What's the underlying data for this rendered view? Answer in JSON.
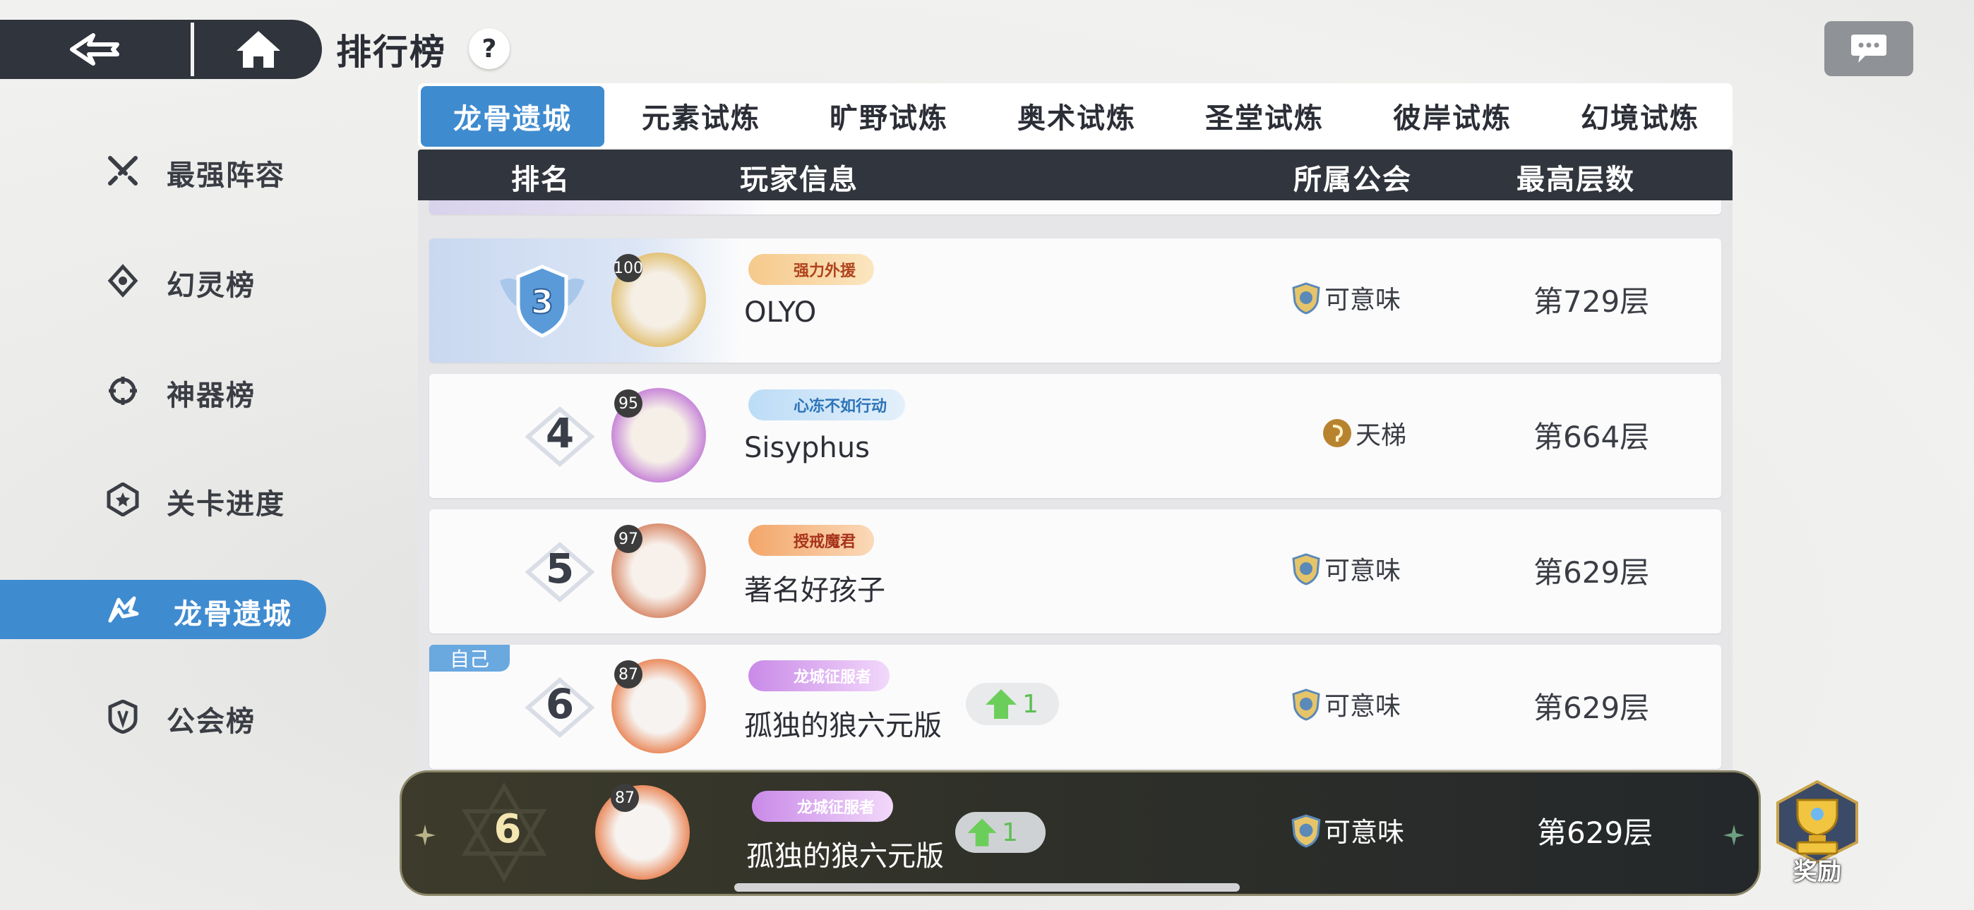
{
  "header": {
    "title": "排行榜",
    "help_label": "?"
  },
  "sidebar": {
    "items": [
      {
        "label": "最强阵容",
        "icon": "swords-icon",
        "active": false
      },
      {
        "label": "幻灵榜",
        "icon": "spirit-icon",
        "active": false
      },
      {
        "label": "神器榜",
        "icon": "artifact-icon",
        "active": false
      },
      {
        "label": "关卡进度",
        "icon": "star-badge-icon",
        "active": false
      },
      {
        "label": "龙骨遗城",
        "icon": "dragon-icon",
        "active": true
      },
      {
        "label": "公会榜",
        "icon": "shield-icon",
        "active": false
      }
    ]
  },
  "tabs": [
    {
      "label": "龙骨遗城",
      "active": true
    },
    {
      "label": "元素试炼",
      "active": false
    },
    {
      "label": "旷野试炼",
      "active": false
    },
    {
      "label": "奥术试炼",
      "active": false
    },
    {
      "label": "圣堂试炼",
      "active": false
    },
    {
      "label": "彼岸试炼",
      "active": false
    },
    {
      "label": "幻境试炼",
      "active": false
    }
  ],
  "table": {
    "columns": [
      "排名",
      "玩家信息",
      "所属公会",
      "最高层数"
    ],
    "rows": [
      {
        "rank": "3",
        "level": "100",
        "title_badge": "强力外援",
        "name": "OLYO",
        "guild": "可意味",
        "floors": "第729层"
      },
      {
        "rank": "4",
        "level": "95",
        "title_badge": "心冻不如行动",
        "name": "Sisyphus",
        "guild": "天梯",
        "floors": "第664层"
      },
      {
        "rank": "5",
        "level": "97",
        "title_badge": "授戒魔君",
        "name": "著名好孩子",
        "guild": "可意味",
        "floors": "第629层"
      },
      {
        "rank": "6",
        "level": "87",
        "title_badge": "龙城征服者",
        "name": "孤独的狼六元版",
        "guild": "可意味",
        "floors": "第629层",
        "self_tag": "自己",
        "change": "1"
      }
    ]
  },
  "my_rank": {
    "rank": "6",
    "level": "87",
    "title_badge": "龙城征服者",
    "name": "孤独的狼六元版",
    "guild": "可意味",
    "floors": "第629层",
    "change": "1"
  },
  "reward": {
    "label": "奖励"
  },
  "colors": {
    "accent": "#3f8bd0",
    "dark": "#31353d",
    "up_green": "#5fbf55"
  }
}
